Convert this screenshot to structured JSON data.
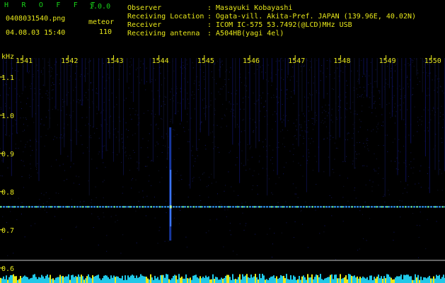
{
  "header": {
    "app_title": "H R O F F T",
    "version": "1.0.0",
    "filename": "0408031540.png",
    "category": "meteor",
    "datetime": "04.08.03 15:40",
    "count": "110",
    "info": [
      {
        "label": "Observer",
        "value": ": Masayuki Kobayashi"
      },
      {
        "label": "Receiving Location",
        "value": ": Ogata-vill. Akita-Pref. JAPAN (139.96E, 40.02N)"
      },
      {
        "label": "Receiver",
        "value": ": ICOM IC-575 53.7492(@LCD)MHz USB"
      },
      {
        "label": "Receiving antenna",
        "value": ": A504HB(yagi 4el)"
      }
    ]
  },
  "spectrogram": {
    "y_axis_unit": "kHz",
    "x_axis_ticks": [
      "1541",
      "1542",
      "1543",
      "1544",
      "1545",
      "1546",
      "1547",
      "1548",
      "1549",
      "1550"
    ],
    "x_range": [
      1540.5,
      1550.3
    ],
    "y_axis_ticks": [
      "1.1",
      "1.0",
      "0.9",
      "0.8",
      "0.7",
      "0.6"
    ],
    "y_range": [
      0.594,
      1.172
    ],
    "carrier_khz": 0.76,
    "reference_khz": 0.62,
    "meteor_time": 1544.25,
    "colors": {
      "background": "#000000",
      "axis_text": "#e8e81a",
      "carrier": "#33a0ff",
      "reference": "#c8c8c8",
      "noise_floor": "#20c8e8"
    }
  }
}
